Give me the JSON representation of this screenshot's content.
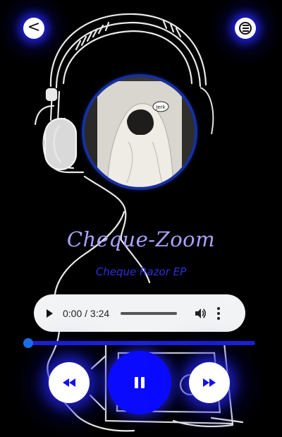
{
  "nav": {
    "back_label": "<"
  },
  "track": {
    "title": "Cheque-Zoom",
    "album": "Cheque Razor EP"
  },
  "player": {
    "time": "0:00 / 3:24",
    "progress": 0.0
  },
  "cover": {
    "tag_text": "Jerk"
  },
  "icons": {
    "back": "chevron-left-icon",
    "menu": "hamburger-menu-icon",
    "play": "play-icon",
    "volume": "volume-icon",
    "more": "more-vertical-icon",
    "rewind": "rewind-icon",
    "pause": "pause-icon",
    "forward": "fast-forward-icon"
  },
  "colors": {
    "background": "#000000",
    "title": "#a9a4ff",
    "album": "#2f2fdc",
    "accent": "#0a0aff",
    "seek_track": "#1f1fd6",
    "seek_thumb": "#1a6fe8",
    "cover_ring": "#1530a0",
    "glow": "#2828ff"
  }
}
